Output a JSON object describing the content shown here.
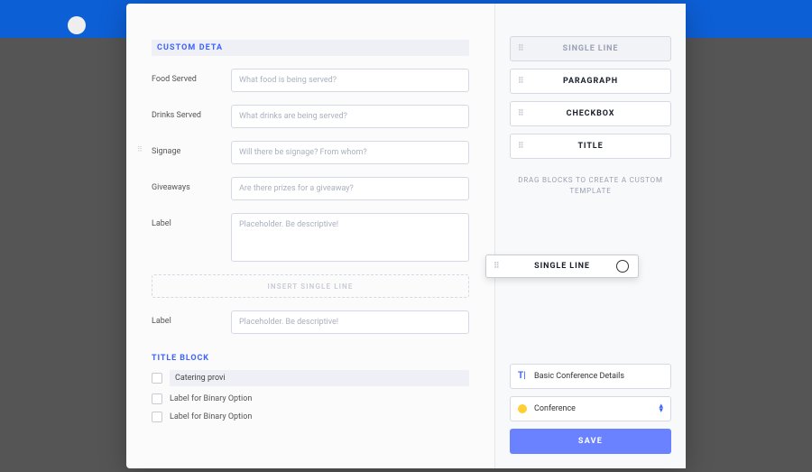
{
  "section_title_value": "CUSTOM DETA",
  "fields": [
    {
      "label": "Food Served",
      "placeholder": "What food is being served?"
    },
    {
      "label": "Drinks Served",
      "placeholder": "What drinks are being served?"
    },
    {
      "label": "Signage",
      "placeholder": "Will there be signage? From whom?"
    },
    {
      "label": "Giveaways",
      "placeholder": "Are there prizes for a giveaway?"
    }
  ],
  "paragraph_field": {
    "label": "Label",
    "placeholder": "Placeholder. Be descriptive!"
  },
  "drop_zone_text": "INSERT SINGLE LINE",
  "drag_ghost_label": "SINGLE LINE",
  "second_single": {
    "label": "Label",
    "placeholder": "Placeholder. Be descriptive!"
  },
  "title_block_heading": "TITLE BLOCK",
  "checkbox_editable_value": "Catering provi",
  "checkbox_static_label": "Label for Binary Option",
  "blocks": {
    "single_line": "SINGLE LINE",
    "paragraph": "PARAGRAPH",
    "checkbox": "CHECKBOX",
    "title": "TITLE"
  },
  "blocks_hint": "DRAG BLOCKS TO CREATE A CUSTOM TEMPLATE",
  "template_name": "Basic Conference Details",
  "category_selected": "Conference",
  "save_label": "SAVE"
}
